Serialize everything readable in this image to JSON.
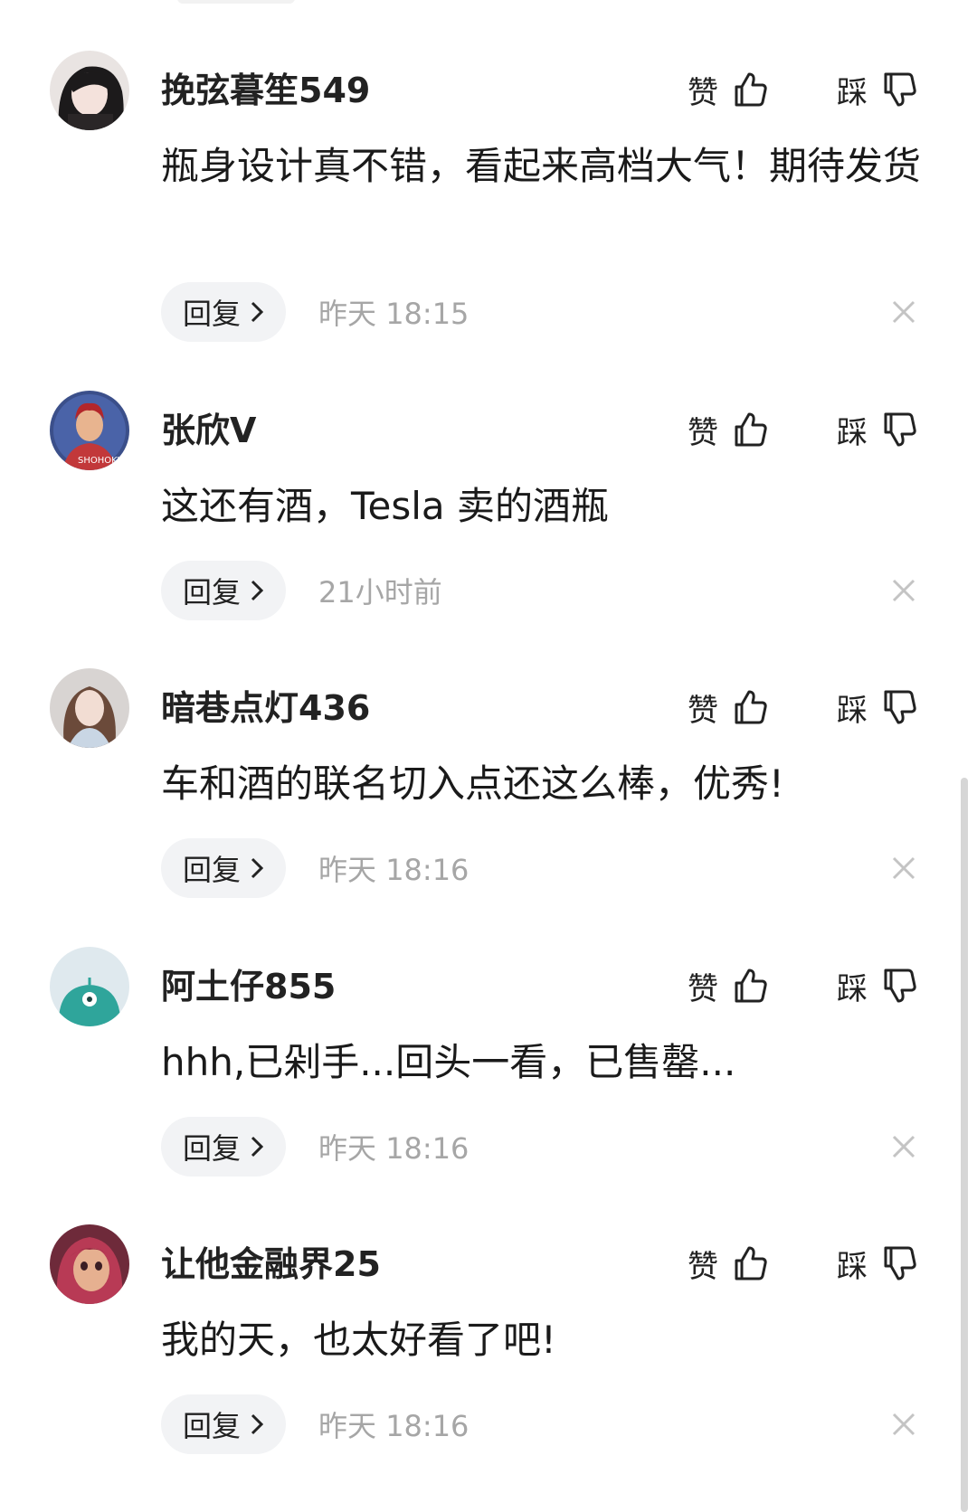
{
  "comments": [
    {
      "username": "挽弦暮笙549",
      "avatar_icon": "avatar-woman-dark-hair-icon",
      "like_label": "赞",
      "dislike_label": "踩",
      "text": "瓶身设计真不错，看起来高档大气！期待发货",
      "reply_label": "回复",
      "time": "昨天 18:15"
    },
    {
      "username": "张欣V",
      "avatar_icon": "avatar-basketball-player-icon",
      "like_label": "赞",
      "dislike_label": "踩",
      "text": "这还有酒，Tesla 卖的酒瓶",
      "reply_label": "回复",
      "time": "21小时前"
    },
    {
      "username": "暗巷点灯436",
      "avatar_icon": "avatar-woman-photo-icon",
      "like_label": "赞",
      "dislike_label": "踩",
      "text": "车和酒的联名切入点还这么棒，优秀!",
      "reply_label": "回复",
      "time": "昨天 18:16"
    },
    {
      "username": "阿土仔855",
      "avatar_icon": "avatar-teal-monster-icon",
      "like_label": "赞",
      "dislike_label": "踩",
      "text": "hhh,已剁手...回头一看，已售罄...",
      "reply_label": "回复",
      "time": "昨天 18:16"
    },
    {
      "username": "让他金融界25",
      "avatar_icon": "avatar-cartoon-red-hair-icon",
      "like_label": "赞",
      "dislike_label": "踩",
      "text": "我的天，也太好看了吧!",
      "reply_label": "回复",
      "time": "昨天 18:16"
    }
  ],
  "colors": {
    "background": "#ffffff",
    "text": "#1a1a1a",
    "time_text": "#a6a6a6",
    "reply_button_bg": "#f2f3f5",
    "close_icon": "#c4c4c4"
  }
}
